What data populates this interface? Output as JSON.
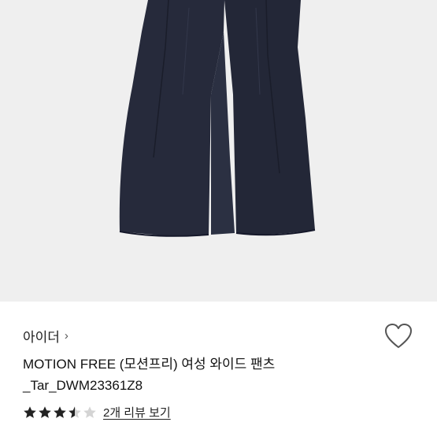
{
  "product": {
    "image_icon": "wide-pants-photo",
    "brand": "아이더",
    "brand_chevron": "›",
    "title_line1": "MOTION FREE (모션프리) 여성 와이드 팬츠",
    "title_line2": "_Tar_DWM23361Z8",
    "rating_value": 3.5,
    "rating_max": 5,
    "review_link": "2개 리뷰 보기"
  },
  "colors": {
    "pants": "#262a3b",
    "photo_bg": "#efefef",
    "star_filled": "#222222",
    "star_empty": "#d4d4d4",
    "heart_stroke": "#555555"
  }
}
